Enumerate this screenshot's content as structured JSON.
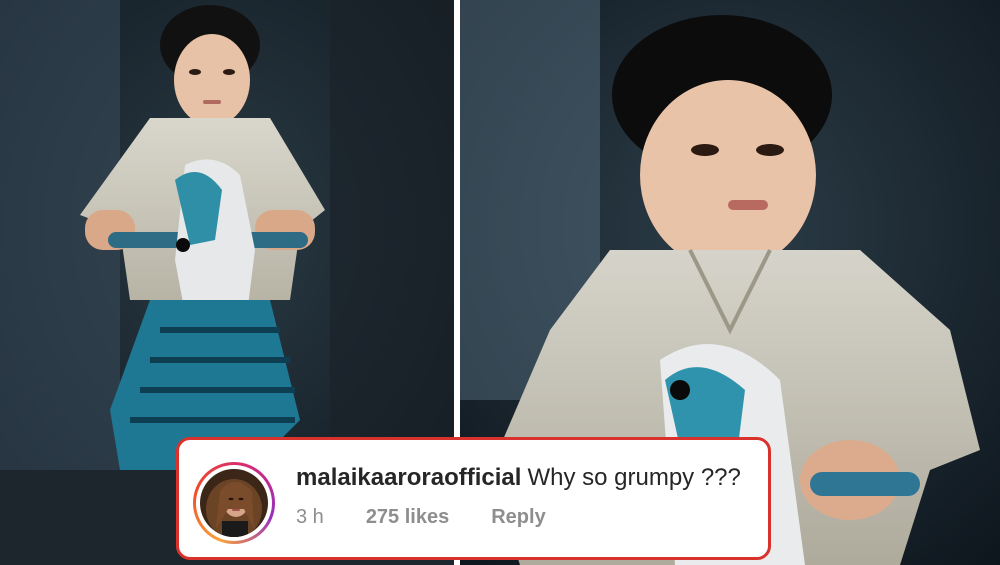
{
  "comment": {
    "username": "malaikaaroraofficial",
    "text": "Why so grumpy ???",
    "time": "3 h",
    "likes": "275 likes",
    "reply_label": "Reply"
  },
  "colors": {
    "card_border": "#d9322d",
    "text_primary": "#262626",
    "text_secondary": "#8e8e8e"
  },
  "icons": {
    "avatar": "profile-photo"
  }
}
